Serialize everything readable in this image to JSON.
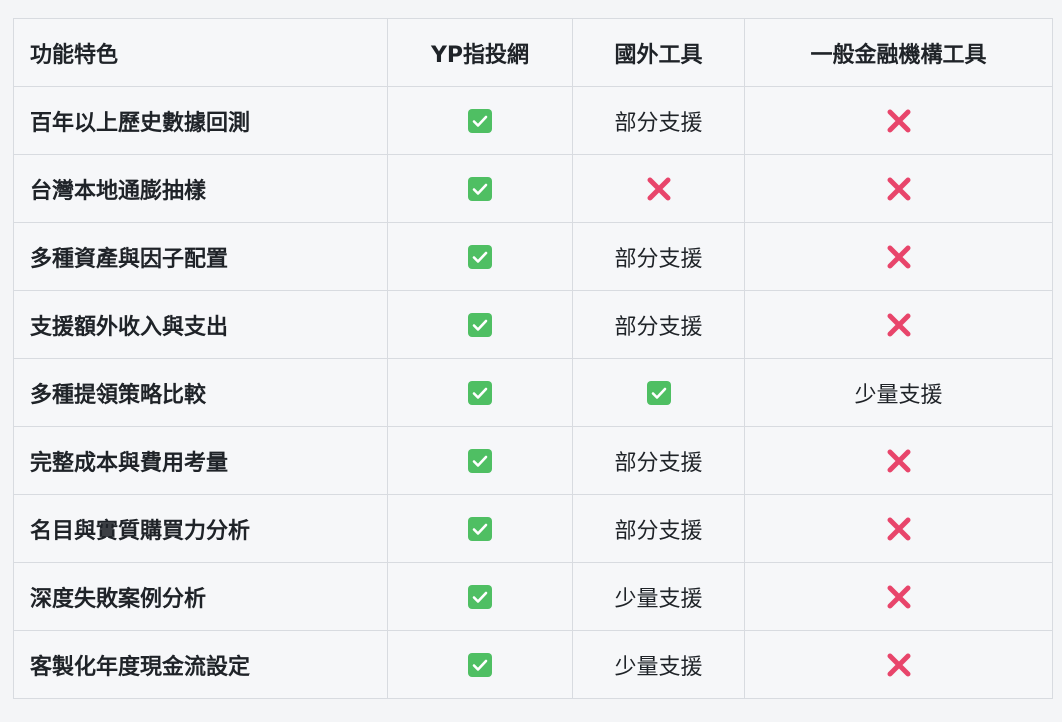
{
  "table": {
    "headers": [
      "功能特色",
      "YP指投網",
      "國外工具",
      "一般金融機構工具"
    ],
    "rows": [
      {
        "feature": "百年以上歷史數據回測",
        "cells": [
          {
            "type": "check"
          },
          {
            "type": "text",
            "text": "部分支援"
          },
          {
            "type": "cross"
          }
        ]
      },
      {
        "feature": "台灣本地通膨抽樣",
        "cells": [
          {
            "type": "check"
          },
          {
            "type": "cross"
          },
          {
            "type": "cross"
          }
        ]
      },
      {
        "feature": "多種資產與因子配置",
        "cells": [
          {
            "type": "check"
          },
          {
            "type": "text",
            "text": "部分支援"
          },
          {
            "type": "cross"
          }
        ]
      },
      {
        "feature": "支援額外收入與支出",
        "cells": [
          {
            "type": "check"
          },
          {
            "type": "text",
            "text": "部分支援"
          },
          {
            "type": "cross"
          }
        ]
      },
      {
        "feature": "多種提領策略比較",
        "cells": [
          {
            "type": "check"
          },
          {
            "type": "check"
          },
          {
            "type": "text",
            "text": "少量支援"
          }
        ]
      },
      {
        "feature": "完整成本與費用考量",
        "cells": [
          {
            "type": "check"
          },
          {
            "type": "text",
            "text": "部分支援"
          },
          {
            "type": "cross"
          }
        ]
      },
      {
        "feature": "名目與實質購買力分析",
        "cells": [
          {
            "type": "check"
          },
          {
            "type": "text",
            "text": "部分支援"
          },
          {
            "type": "cross"
          }
        ]
      },
      {
        "feature": "深度失敗案例分析",
        "cells": [
          {
            "type": "check"
          },
          {
            "type": "text",
            "text": "少量支援"
          },
          {
            "type": "cross"
          }
        ]
      },
      {
        "feature": "客製化年度現金流設定",
        "cells": [
          {
            "type": "check"
          },
          {
            "type": "text",
            "text": "少量支援"
          },
          {
            "type": "cross"
          }
        ]
      }
    ]
  },
  "icons": {
    "check": "check-mark-button-icon",
    "cross": "cross-mark-icon"
  },
  "colors": {
    "check_bg": "#4fbf63",
    "cross": "#e8456b",
    "border": "#d8dbe0",
    "background": "#f6f7f9"
  }
}
